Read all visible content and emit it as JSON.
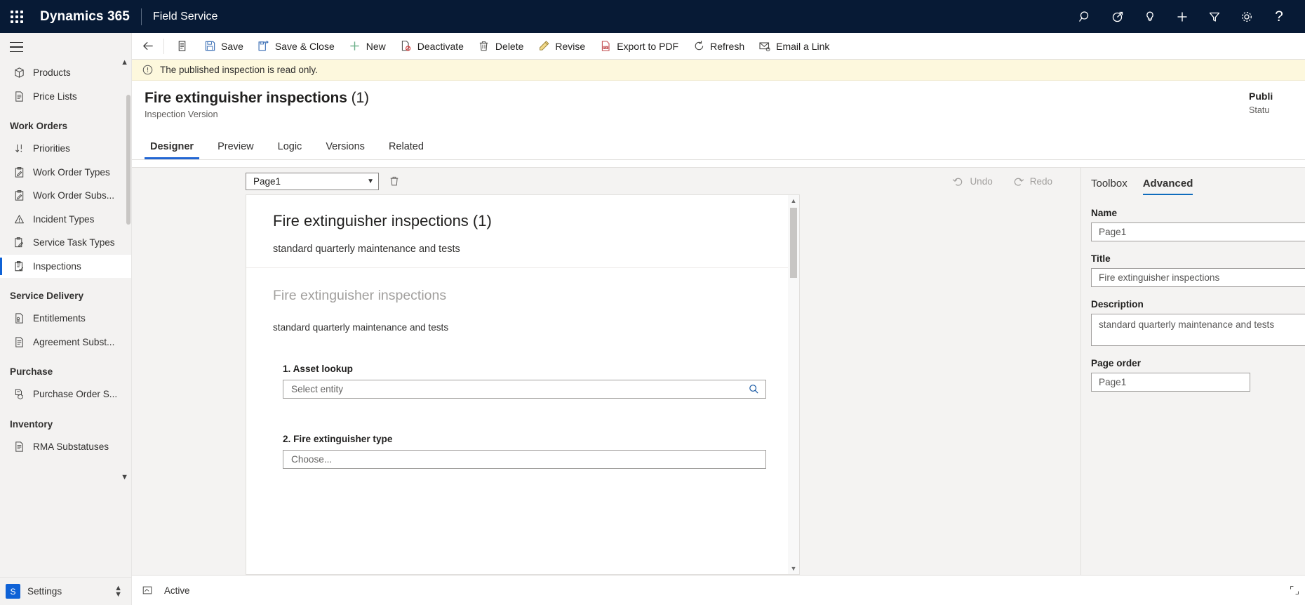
{
  "header": {
    "waffle_icon": "app-launcher-icon",
    "brand": "Dynamics 365",
    "app_name": "Field Service",
    "icons": [
      {
        "name": "search-icon",
        "label": "Search"
      },
      {
        "name": "diagnostics-icon",
        "label": "Diagnostics"
      },
      {
        "name": "lightbulb-icon",
        "label": "Tips"
      },
      {
        "name": "plus-icon",
        "label": "Quick create"
      },
      {
        "name": "filter-icon",
        "label": "Filter"
      },
      {
        "name": "gear-icon",
        "label": "Settings"
      },
      {
        "name": "help-icon",
        "label": "Help"
      }
    ]
  },
  "sidebar": {
    "hamburger": "menu-icon",
    "items": [
      {
        "label": "Products",
        "icon": "box-icon",
        "type": "item",
        "selected": false
      },
      {
        "label": "Price Lists",
        "icon": "document-lines-icon",
        "type": "item",
        "selected": false
      },
      {
        "label": "Work Orders",
        "type": "group"
      },
      {
        "label": "Priorities",
        "icon": "sort-arrows-icon",
        "type": "item",
        "selected": false
      },
      {
        "label": "Work Order Types",
        "icon": "clipboard-pen-icon",
        "type": "item",
        "selected": false
      },
      {
        "label": "Work Order Subs...",
        "icon": "clipboard-pen-icon",
        "type": "item",
        "selected": false
      },
      {
        "label": "Incident Types",
        "icon": "warning-triangle-icon",
        "type": "item",
        "selected": false
      },
      {
        "label": "Service Task Types",
        "icon": "clipboard-task-icon",
        "type": "item",
        "selected": false
      },
      {
        "label": "Inspections",
        "icon": "clipboard-check-icon",
        "type": "item",
        "selected": true
      },
      {
        "label": "Service Delivery",
        "type": "group"
      },
      {
        "label": "Entitlements",
        "icon": "document-seal-icon",
        "type": "item",
        "selected": false
      },
      {
        "label": "Agreement Subst...",
        "icon": "document-lines-icon",
        "type": "item",
        "selected": false
      },
      {
        "label": "Purchase",
        "type": "group"
      },
      {
        "label": "Purchase Order S...",
        "icon": "document-box-icon",
        "type": "item",
        "selected": false
      },
      {
        "label": "Inventory",
        "type": "group"
      },
      {
        "label": "RMA Substatuses",
        "icon": "document-lines-icon",
        "type": "item",
        "selected": false
      }
    ],
    "area_switcher": {
      "badge": "S",
      "label": "Settings",
      "chevron_icon": "up-down-chevron-icon"
    }
  },
  "commandbar": {
    "back_icon": "back-arrow-icon",
    "form_icon": "form-selector-icon",
    "buttons": [
      {
        "label": "Save",
        "icon": "save-icon"
      },
      {
        "label": "Save & Close",
        "icon": "save-close-icon"
      },
      {
        "label": "New",
        "icon": "plus-icon"
      },
      {
        "label": "Deactivate",
        "icon": "deactivate-icon"
      },
      {
        "label": "Delete",
        "icon": "trash-icon"
      },
      {
        "label": "Revise",
        "icon": "pencil-icon"
      },
      {
        "label": "Export to PDF",
        "icon": "pdf-icon"
      },
      {
        "label": "Refresh",
        "icon": "refresh-icon"
      },
      {
        "label": "Email a Link",
        "icon": "email-link-icon"
      }
    ]
  },
  "notification": {
    "icon": "info-circle-icon",
    "text": "The published inspection is read only."
  },
  "record": {
    "title": "Fire extinguisher inspections (1)",
    "title_main": "Fire extinguisher inspections",
    "title_suffix": " (1)",
    "subtitle": "Inspection Version",
    "status_value": "Publi",
    "status_label": "Statu"
  },
  "tabs": [
    {
      "label": "Designer",
      "active": true
    },
    {
      "label": "Preview",
      "active": false
    },
    {
      "label": "Logic",
      "active": false
    },
    {
      "label": "Versions",
      "active": false
    },
    {
      "label": "Related",
      "active": false
    }
  ],
  "designer": {
    "page_select_value": "Page1",
    "page_select_chevron": "chevron-down-icon",
    "delete_page_icon": "trash-icon",
    "undo": {
      "label": "Undo",
      "icon": "undo-icon"
    },
    "redo": {
      "label": "Redo",
      "icon": "redo-icon"
    },
    "canvas": {
      "title": "Fire extinguisher inspections (1)",
      "description": "standard quarterly maintenance and tests",
      "section_title": "Fire extinguisher inspections",
      "section_description": "standard quarterly maintenance and tests",
      "questions": [
        {
          "label": "1. Asset lookup",
          "placeholder": "Select entity",
          "icon": "search-icon",
          "type": "lookup"
        },
        {
          "label": "2. Fire extinguisher type",
          "placeholder": "Choose...",
          "icon": "",
          "type": "choice"
        }
      ],
      "scroll_up_icon": "caret-up-icon",
      "scroll_down_icon": "caret-down-icon"
    }
  },
  "rightpanel": {
    "tabs": [
      {
        "label": "Toolbox",
        "active": false
      },
      {
        "label": "Advanced",
        "active": true
      }
    ],
    "fields": [
      {
        "label": "Name",
        "value": "Page1",
        "type": "text"
      },
      {
        "label": "Title",
        "value": "Fire extinguisher inspections",
        "type": "text"
      },
      {
        "label": "Description",
        "value": "standard quarterly maintenance and tests",
        "type": "textarea"
      },
      {
        "label": "Page order",
        "value": "Page1",
        "type": "text"
      }
    ]
  },
  "footer": {
    "icon": "form-state-icon",
    "status": "Active",
    "resize_icon": "expand-icon"
  },
  "colors": {
    "header_bg": "#071A35",
    "accent": "#0f62d6",
    "tab_underline": "#2266d3",
    "panel_tab_underline": "#0f6cbd",
    "notification_bg": "#fdf8dd",
    "sidebar_bg": "#f3f2f1",
    "designer_bg": "#f4f3f2"
  }
}
